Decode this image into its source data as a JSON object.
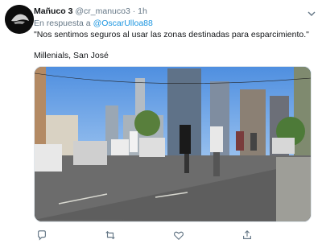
{
  "tweet": {
    "author_name": "Mañuco 3",
    "handle": "@cr_manuco3",
    "separator": "·",
    "time": "1h",
    "reply_prefix": "En respuesta a",
    "reply_mention": "@OscarUlloa88",
    "text": "\"Nos sentimos seguros al usar las zonas destinadas para esparcimiento.\"",
    "text2": "Millenials, San José"
  },
  "actions": {
    "icons": [
      "reply-icon",
      "retweet-icon",
      "like-icon",
      "share-icon"
    ]
  },
  "colors": {
    "link": "#1b95e0",
    "muted": "#657786",
    "text": "#14171a"
  }
}
